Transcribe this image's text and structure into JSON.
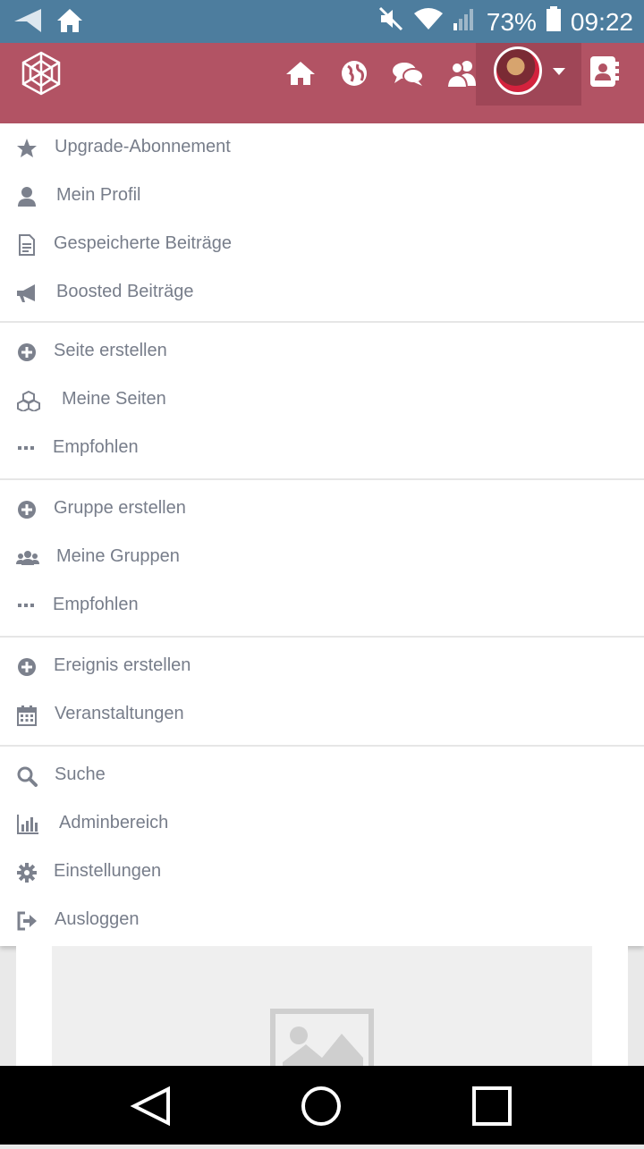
{
  "status_bar": {
    "battery": "73%",
    "time": "09:22",
    "icons": [
      "navigation-icon",
      "home-icon",
      "mute-icon",
      "wifi-icon",
      "signal-icon",
      "battery-icon"
    ]
  },
  "header": {
    "icons": [
      "home-icon",
      "globe-icon",
      "chat-icon",
      "friends-icon",
      "avatar",
      "contacts-icon"
    ],
    "colors": {
      "bar": "#b25364",
      "active": "#9f4657"
    }
  },
  "menu": {
    "sections": [
      {
        "items": [
          {
            "label": "Upgrade-Abonnement",
            "icon": "star-icon"
          },
          {
            "label": "Mein Profil",
            "icon": "user-icon"
          },
          {
            "label": "Gespeicherte Beiträge",
            "icon": "document-icon"
          },
          {
            "label": "Boosted Beiträge",
            "icon": "megaphone-icon"
          }
        ]
      },
      {
        "items": [
          {
            "label": "Seite erstellen",
            "icon": "plus-circle-icon"
          },
          {
            "label": "Meine Seiten",
            "icon": "cubes-icon"
          },
          {
            "label": "Empfohlen",
            "icon": "ellipsis-icon"
          }
        ]
      },
      {
        "items": [
          {
            "label": "Gruppe erstellen",
            "icon": "plus-circle-icon"
          },
          {
            "label": "Meine Gruppen",
            "icon": "users-icon"
          },
          {
            "label": "Empfohlen",
            "icon": "ellipsis-icon"
          }
        ]
      },
      {
        "items": [
          {
            "label": "Ereignis erstellen",
            "icon": "plus-circle-icon"
          },
          {
            "label": "Veranstaltungen",
            "icon": "calendar-icon"
          }
        ]
      },
      {
        "items": [
          {
            "label": "Suche",
            "icon": "search-icon"
          },
          {
            "label": "Adminbereich",
            "icon": "bar-chart-icon"
          },
          {
            "label": "Einstellungen",
            "icon": "gear-icon"
          },
          {
            "label": "Ausloggen",
            "icon": "logout-icon"
          }
        ]
      }
    ]
  },
  "nav_bar": {
    "icons": [
      "back-icon",
      "home-circle-icon",
      "recents-icon"
    ]
  }
}
